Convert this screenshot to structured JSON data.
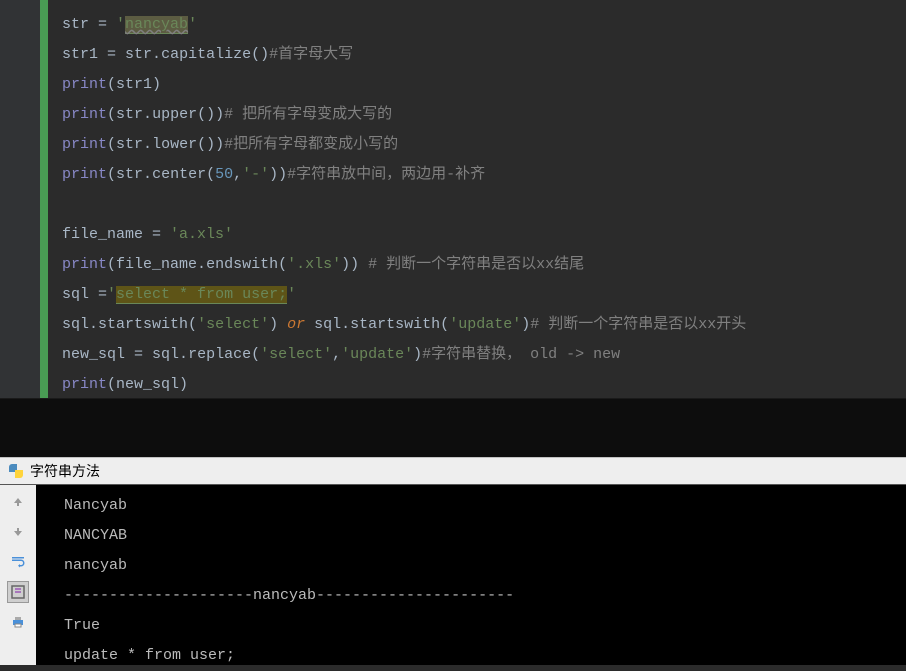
{
  "code": {
    "line1": {
      "var": "str",
      "eq": " = ",
      "quote1": "'",
      "val": "nancyab",
      "quote2": "'"
    },
    "line2": {
      "var": "str1",
      "eq": " = ",
      "obj": "str",
      "dot": ".",
      "method": "capitalize",
      "parens": "()",
      "comment": "#首字母大写"
    },
    "line3": {
      "fn": "print",
      "open": "(",
      "arg": "str1",
      "close": ")"
    },
    "line4": {
      "fn": "print",
      "open": "(",
      "obj": "str",
      "dot": ".",
      "method": "upper",
      "parens": "()",
      "close": ")",
      "comment": "# 把所有字母变成大写的"
    },
    "line5": {
      "fn": "print",
      "open": "(",
      "obj": "str",
      "dot": ".",
      "method": "lower",
      "parens": "()",
      "close": ")",
      "comment": "#把所有字母都变成小写的"
    },
    "line6": {
      "fn": "print",
      "open": "(",
      "obj": "str",
      "dot": ".",
      "method": "center",
      "popen": "(",
      "num": "50",
      "comma": ",",
      "str": "'-'",
      "pclose": ")",
      "close": ")",
      "comment": "#字符串放中间，两边用-补齐"
    },
    "line8": {
      "var": "file_name",
      "eq": " = ",
      "str": "'a.xls'"
    },
    "line9": {
      "fn": "print",
      "open": "(",
      "obj": "file_name",
      "dot": ".",
      "method": "endswith",
      "popen": "(",
      "str": "'.xls'",
      "pclose": ")",
      "close": ") ",
      "comment": "# 判断一个字符串是否以xx结尾"
    },
    "line10": {
      "var": "sql",
      "eq": " =",
      "quote1": "'",
      "val": "select * from user;",
      "quote2": "'"
    },
    "line11": {
      "obj1": "sql",
      "dot1": ".",
      "m1": "startswith",
      "p1": "(",
      "s1": "'select'",
      "p2": ") ",
      "or": "or",
      "sp": " ",
      "obj2": "sql",
      "dot2": ".",
      "m2": "startswith",
      "p3": "(",
      "s2": "'update'",
      "p4": ")",
      "comment": "# 判断一个字符串是否以xx开头"
    },
    "line12": {
      "var": "new_sql",
      "eq": " = ",
      "obj": "sql",
      "dot": ".",
      "method": "replace",
      "popen": "(",
      "s1": "'select'",
      "comma": ",",
      "s2": "'update'",
      "pclose": ")",
      "comment": "#字符串替换， old -> new"
    },
    "line13": {
      "fn": "print",
      "open": "(",
      "arg": "new_sql",
      "close": ")"
    }
  },
  "console_tab": "字符串方法",
  "output": {
    "l1": "Nancyab",
    "l2": "NANCYAB",
    "l3": "nancyab",
    "l4": "---------------------nancyab----------------------",
    "l5": "True",
    "l6": "update * from user;"
  }
}
